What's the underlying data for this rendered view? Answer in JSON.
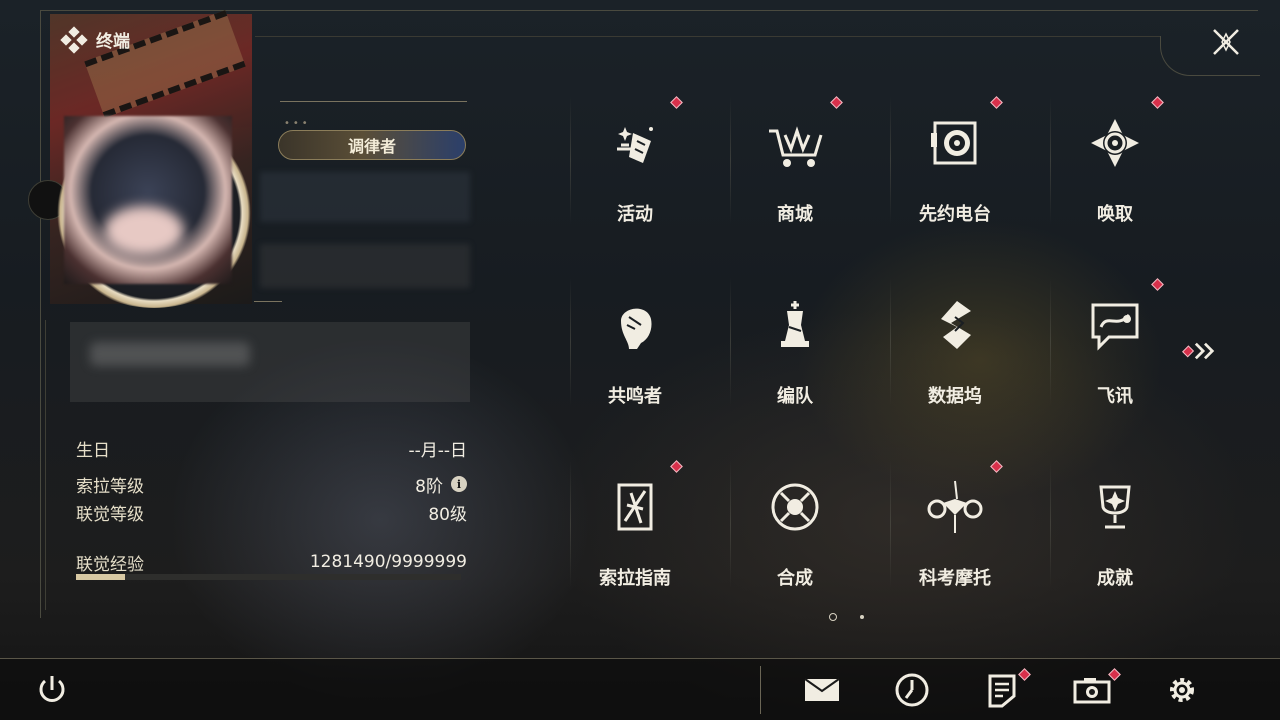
{
  "header": {
    "title": "终端"
  },
  "profile": {
    "title_badge": "调律者",
    "info": [
      {
        "label": "生日",
        "value": "--月--日"
      },
      {
        "label": "索拉等级",
        "value": "8阶",
        "has_info_icon": true
      },
      {
        "label": "联觉等级",
        "value": "80级"
      },
      {
        "label": "联觉经验",
        "value": "1281490/9999999"
      }
    ],
    "exp_progress": 0.128
  },
  "grid": {
    "items": [
      {
        "label": "活动",
        "icon": "activity-icon",
        "badge": true
      },
      {
        "label": "商城",
        "icon": "shop-icon",
        "badge": true
      },
      {
        "label": "先约电台",
        "icon": "radio-icon",
        "badge": true
      },
      {
        "label": "唤取",
        "icon": "convene-icon",
        "badge": true
      },
      {
        "label": "共鸣者",
        "icon": "resonator-icon",
        "badge": false
      },
      {
        "label": "编队",
        "icon": "team-icon",
        "badge": false
      },
      {
        "label": "数据坞",
        "icon": "data-bank-icon",
        "badge": false
      },
      {
        "label": "飞讯",
        "icon": "message-icon",
        "badge": true
      },
      {
        "label": "索拉指南",
        "icon": "guidebook-icon",
        "badge": true
      },
      {
        "label": "合成",
        "icon": "synthesis-icon",
        "badge": false
      },
      {
        "label": "科考摩托",
        "icon": "motorbike-icon",
        "badge": true
      },
      {
        "label": "成就",
        "icon": "achievement-icon",
        "badge": false
      }
    ],
    "page_indicator": {
      "current": 1,
      "total": 2
    }
  },
  "bottom_bar": {
    "buttons": [
      {
        "name": "mail",
        "badge": false
      },
      {
        "name": "clock",
        "badge": false
      },
      {
        "name": "notice",
        "badge": true
      },
      {
        "name": "camera",
        "badge": true
      },
      {
        "name": "settings",
        "badge": false
      }
    ]
  },
  "colors": {
    "accent_badge": "#d8304b",
    "text": "#f1ede2",
    "gold": "#d8c9a3"
  }
}
